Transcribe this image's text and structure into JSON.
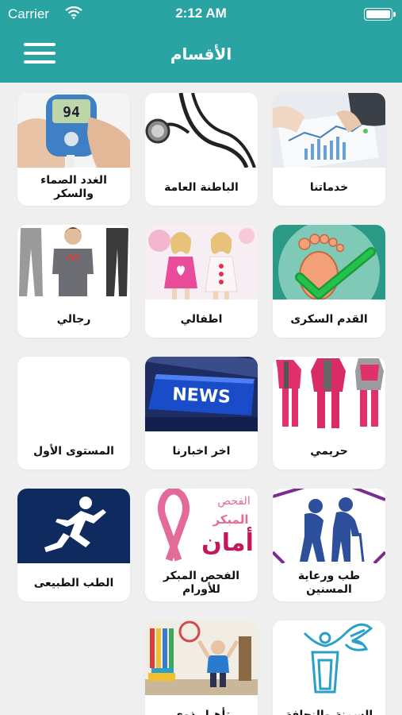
{
  "status_bar": {
    "carrier": "Carrier",
    "time": "2:12 AM"
  },
  "nav": {
    "title": "الأقسام"
  },
  "categories": [
    {
      "label": "خدماتنا",
      "icon": "charts-documents-image"
    },
    {
      "label": "الباطنة العامة",
      "icon": "stethoscope-image"
    },
    {
      "label": "الغدد الصماء والسكر",
      "icon": "glucose-meter-image"
    },
    {
      "label": "القدم السكرى",
      "icon": "foot-checkmark-image"
    },
    {
      "label": "اطفالي",
      "icon": "children-image"
    },
    {
      "label": "رجالي",
      "icon": "mens-clothing-image"
    },
    {
      "label": "حريمي",
      "icon": "womens-clothing-image"
    },
    {
      "label": "اخر اخبارنا",
      "icon": "news-key-image",
      "image_text": "NEWS"
    },
    {
      "label": "المستوى الأول",
      "icon": ""
    },
    {
      "label": "طب ورعاية المسنين",
      "icon": "elderly-couple-image"
    },
    {
      "label": "الفحص المبكر للأورام",
      "icon": "pink-ribbon-image",
      "image_text": [
        "الفحص",
        "المبكر",
        "أمان"
      ]
    },
    {
      "label": "الطب الطبيعى",
      "icon": "runner-image"
    },
    {
      "label": "السمنة والنحافة",
      "icon": "body-waist-image"
    },
    {
      "label": "تأهيل ذوى",
      "icon": "rehab-room-image"
    }
  ],
  "colors": {
    "brand": "#2aa3a3",
    "background": "#efefef",
    "card": "#ffffff"
  }
}
